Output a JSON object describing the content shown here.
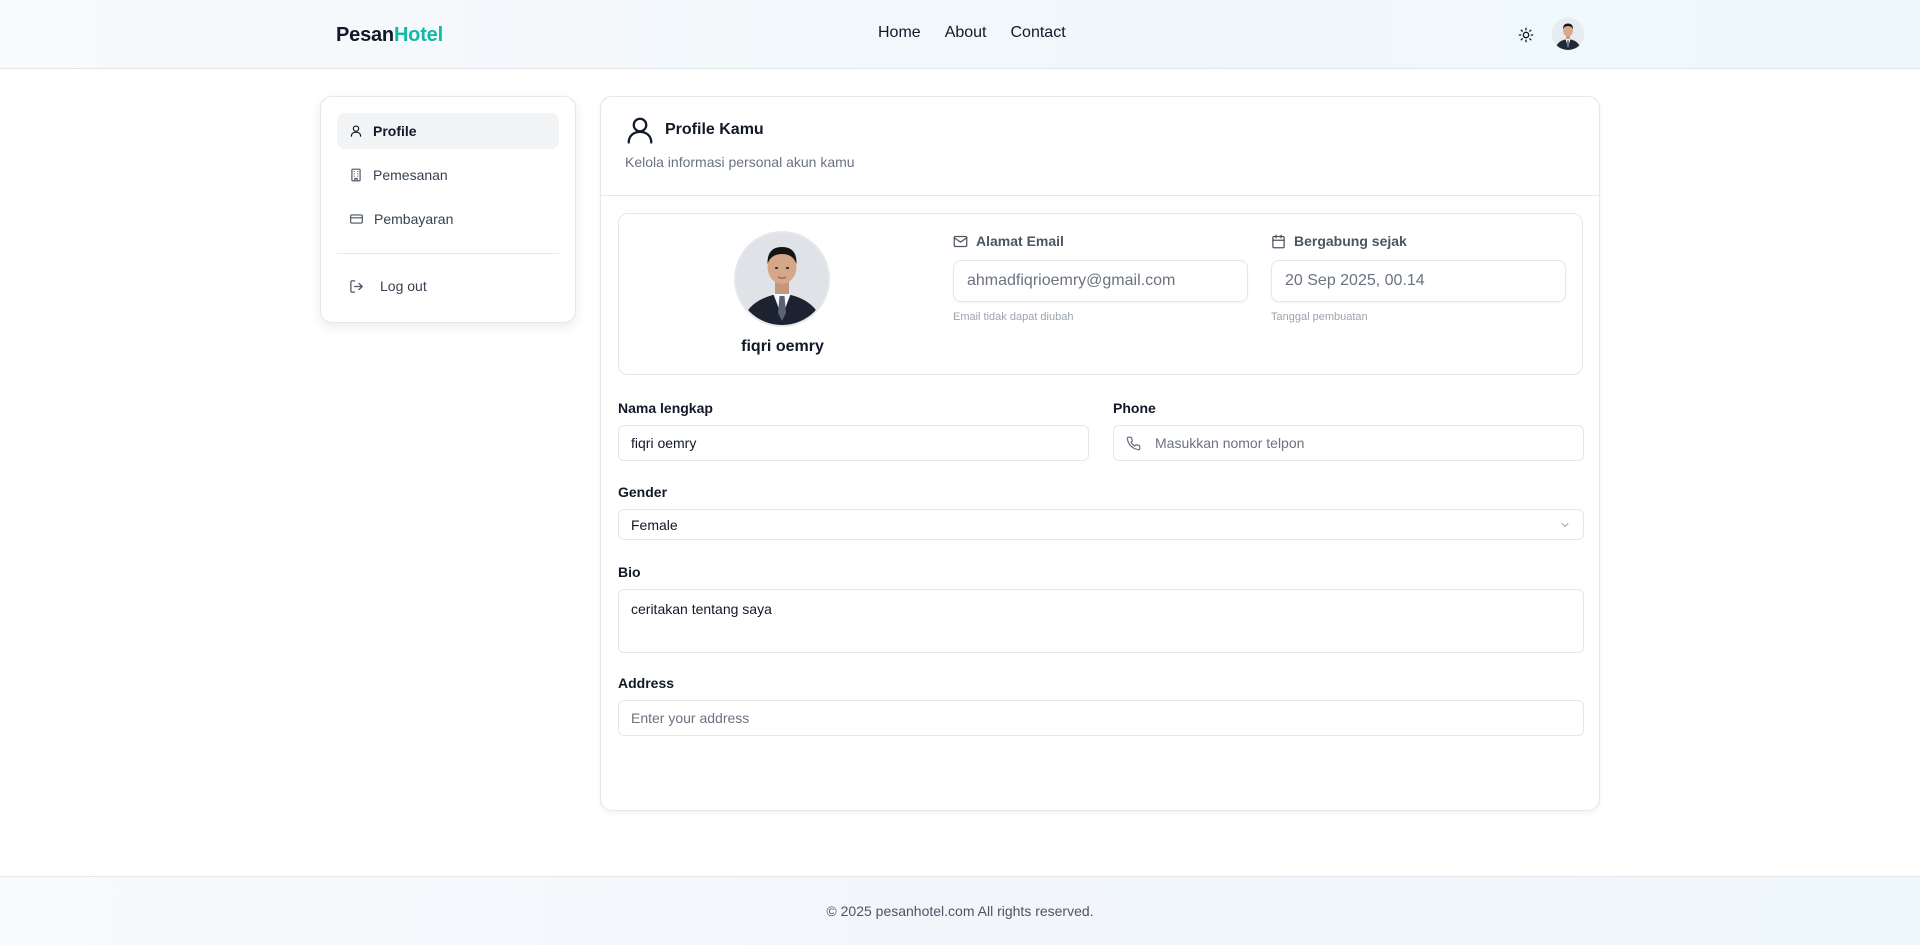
{
  "brand": {
    "part1": "Pesan",
    "part2": "Hotel"
  },
  "nav": {
    "home": "Home",
    "about": "About",
    "contact": "Contact"
  },
  "header_icons": {
    "theme": "sun-icon",
    "avatar": "user-avatar"
  },
  "sidebar": {
    "items": [
      {
        "label": "Profile",
        "icon": "user-icon",
        "active": true
      },
      {
        "label": "Pemesanan",
        "icon": "building-icon",
        "active": false
      },
      {
        "label": "Pembayaran",
        "icon": "credit-card-icon",
        "active": false
      }
    ],
    "logout": "Log out"
  },
  "profile": {
    "title": "Profile Kamu",
    "subtitle": "Kelola informasi personal akun kamu",
    "name": "fiqri oemry",
    "email": {
      "label": "Alamat Email",
      "value": "ahmadfiqrioemry@gmail.com",
      "hint": "Email tidak dapat diubah"
    },
    "joined": {
      "label": "Bergabung sejak",
      "value": "20 Sep 2025, 00.14",
      "hint": "Tanggal pembuatan"
    }
  },
  "form": {
    "fullname": {
      "label": "Nama lengkap",
      "value": "fiqri oemry"
    },
    "phone": {
      "label": "Phone",
      "placeholder": "Masukkan nomor telpon"
    },
    "gender": {
      "label": "Gender",
      "value": "Female"
    },
    "bio": {
      "label": "Bio",
      "value": "ceritakan tentang saya"
    },
    "address": {
      "label": "Address",
      "placeholder": "Enter your address"
    }
  },
  "footer": {
    "text": "© 2025 pesanhotel.com All rights reserved."
  },
  "colors": {
    "brand_accent": "#14b8a6",
    "active_bg": "#f3f4f6",
    "border": "#e5e7eb"
  }
}
